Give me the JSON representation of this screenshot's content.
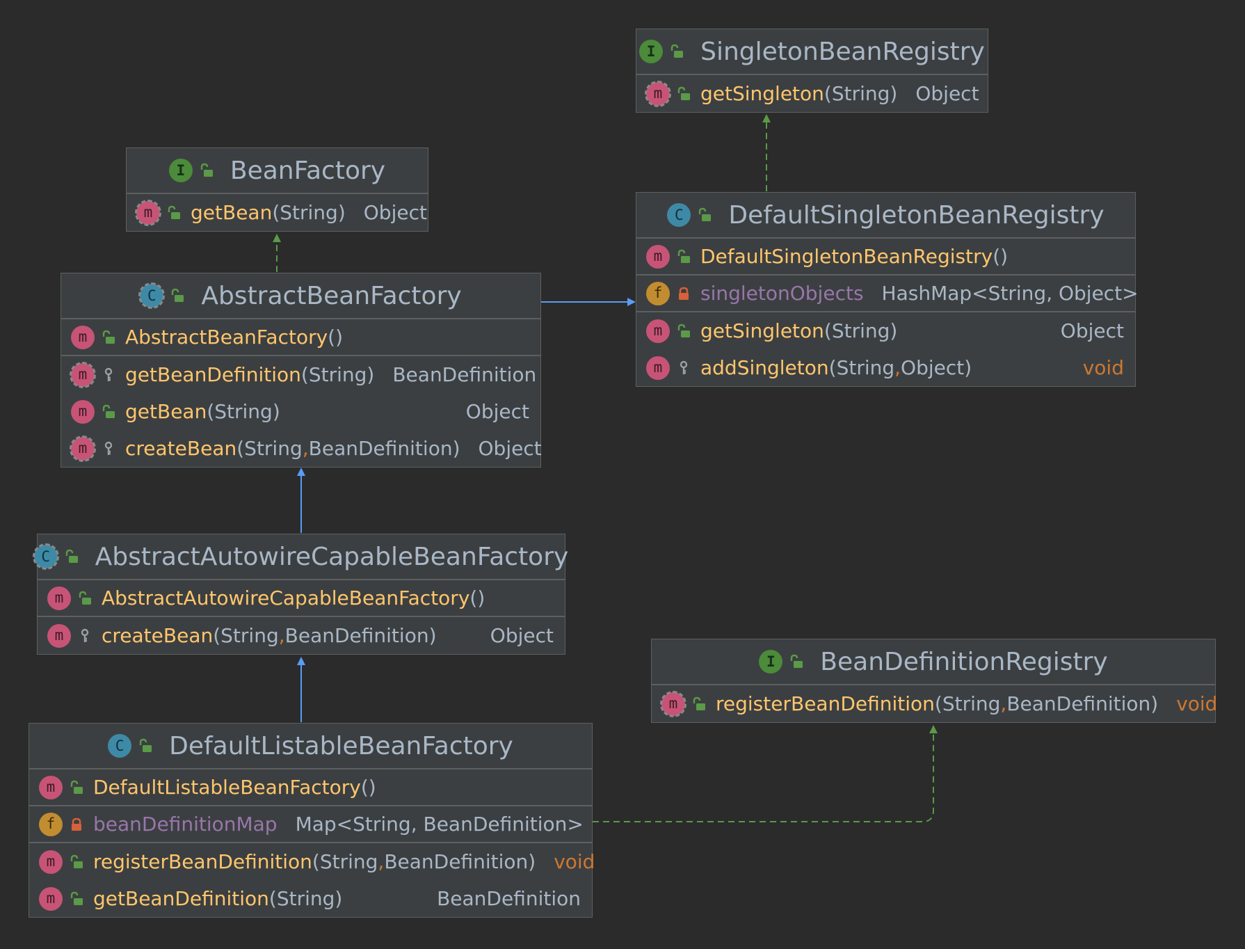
{
  "colors": {
    "background": "#2b2b2b",
    "box": "#3c3f41",
    "border": "#5e6060",
    "method_name": "#ffc66d",
    "field_name": "#9876aa",
    "keyword": "#cc7832",
    "inheritance_arrow": "#589df6",
    "realization_arrow": "#5a9a48",
    "badge_method": "#c75476",
    "badge_field": "#c28d30",
    "badge_class": "#3e8aa6",
    "badge_interface": "#4b8b3a"
  },
  "classes": {
    "singleton_bean_registry": {
      "kind": "interface",
      "kind_letter": "I",
      "kind_icon": "interface-icon",
      "name": "SingletonBeanRegistry",
      "rows": [
        {
          "icon": "abstract-method-icon",
          "badge": "m",
          "vis": "public",
          "name": "getSingleton",
          "params": [
            "String"
          ],
          "ret": "Object"
        }
      ]
    },
    "bean_factory": {
      "kind": "interface",
      "kind_letter": "I",
      "kind_icon": "interface-icon",
      "name": "BeanFactory",
      "rows": [
        {
          "icon": "abstract-method-icon",
          "badge": "m",
          "vis": "public",
          "name": "getBean",
          "params": [
            "String"
          ],
          "ret": "Object"
        }
      ]
    },
    "default_singleton_bean_registry": {
      "kind": "class",
      "kind_letter": "C",
      "kind_icon": "class-icon",
      "name": "DefaultSingletonBeanRegistry",
      "rows": [
        {
          "icon": "method-icon",
          "badge": "m",
          "vis": "public",
          "name": "DefaultSingletonBeanRegistry",
          "params": [],
          "ret": ""
        },
        {
          "icon": "field-icon",
          "badge": "f",
          "vis": "private",
          "name": "singletonObjects",
          "type": "HashMap<String, Object>"
        },
        {
          "icon": "method-icon",
          "badge": "m",
          "vis": "public",
          "name": "getSingleton",
          "params": [
            "String"
          ],
          "ret": "Object"
        },
        {
          "icon": "method-icon",
          "badge": "m",
          "vis": "protected",
          "name": "addSingleton",
          "params": [
            "String",
            "Object"
          ],
          "ret": "void"
        }
      ]
    },
    "abstract_bean_factory": {
      "kind": "abstract-class",
      "kind_letter": "C",
      "kind_icon": "abstract-class-icon",
      "name": "AbstractBeanFactory",
      "rows": [
        {
          "icon": "method-icon",
          "badge": "m",
          "vis": "public",
          "name": "AbstractBeanFactory",
          "params": [],
          "ret": ""
        },
        {
          "icon": "abstract-method-icon",
          "badge": "m",
          "vis": "protected",
          "name": "getBeanDefinition",
          "params": [
            "String"
          ],
          "ret": "BeanDefinition"
        },
        {
          "icon": "method-icon",
          "badge": "m",
          "vis": "public",
          "name": "getBean",
          "params": [
            "String"
          ],
          "ret": "Object"
        },
        {
          "icon": "abstract-method-icon",
          "badge": "m",
          "vis": "protected",
          "name": "createBean",
          "params": [
            "String",
            "BeanDefinition"
          ],
          "ret": "Object"
        }
      ]
    },
    "abstract_autowire_capable_bean_factory": {
      "kind": "abstract-class",
      "kind_letter": "C",
      "kind_icon": "abstract-class-icon",
      "name": "AbstractAutowireCapableBeanFactory",
      "rows": [
        {
          "icon": "method-icon",
          "badge": "m",
          "vis": "public",
          "name": "AbstractAutowireCapableBeanFactory",
          "params": [],
          "ret": ""
        },
        {
          "icon": "method-icon",
          "badge": "m",
          "vis": "protected",
          "name": "createBean",
          "params": [
            "String",
            "BeanDefinition"
          ],
          "ret": "Object"
        }
      ]
    },
    "bean_definition_registry": {
      "kind": "interface",
      "kind_letter": "I",
      "kind_icon": "interface-icon",
      "name": "BeanDefinitionRegistry",
      "rows": [
        {
          "icon": "abstract-method-icon",
          "badge": "m",
          "vis": "public",
          "name": "registerBeanDefinition",
          "params": [
            "String",
            "BeanDefinition"
          ],
          "ret": "void"
        }
      ]
    },
    "default_listable_bean_factory": {
      "kind": "class",
      "kind_letter": "C",
      "kind_icon": "class-icon",
      "name": "DefaultListableBeanFactory",
      "rows": [
        {
          "icon": "method-icon",
          "badge": "m",
          "vis": "public",
          "name": "DefaultListableBeanFactory",
          "params": [],
          "ret": ""
        },
        {
          "icon": "field-icon",
          "badge": "f",
          "vis": "private",
          "name": "beanDefinitionMap",
          "type": "Map<String, BeanDefinition>"
        },
        {
          "icon": "method-icon",
          "badge": "m",
          "vis": "public",
          "name": "registerBeanDefinition",
          "params": [
            "String",
            "BeanDefinition"
          ],
          "ret": "void"
        },
        {
          "icon": "method-icon",
          "badge": "m",
          "vis": "public",
          "name": "getBeanDefinition",
          "params": [
            "String"
          ],
          "ret": "BeanDefinition"
        }
      ]
    }
  },
  "relations": [
    {
      "from": "abstract_bean_factory",
      "to": "bean_factory",
      "type": "realization"
    },
    {
      "from": "default_singleton_bean_registry",
      "to": "singleton_bean_registry",
      "type": "realization"
    },
    {
      "from": "abstract_bean_factory",
      "to": "default_singleton_bean_registry",
      "type": "generalization"
    },
    {
      "from": "abstract_autowire_capable_bean_factory",
      "to": "abstract_bean_factory",
      "type": "generalization"
    },
    {
      "from": "default_listable_bean_factory",
      "to": "abstract_autowire_capable_bean_factory",
      "type": "generalization"
    },
    {
      "from": "default_listable_bean_factory",
      "to": "bean_definition_registry",
      "type": "realization"
    }
  ]
}
